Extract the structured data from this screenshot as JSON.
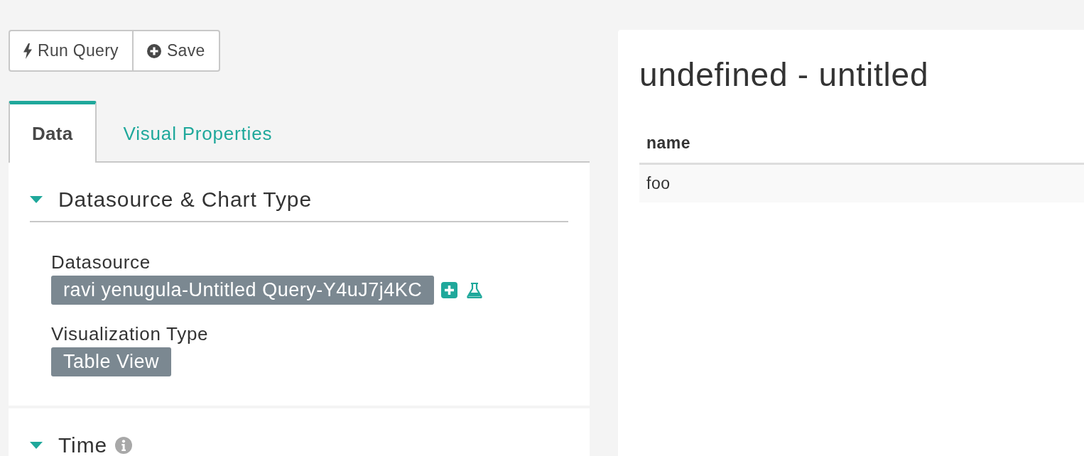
{
  "toolbar": {
    "buttons": [
      {
        "kind": "run",
        "label": "Run Query"
      },
      {
        "kind": "save",
        "label": "Save"
      }
    ]
  },
  "tabs": [
    {
      "label": "Data",
      "selected": true
    },
    {
      "label": "Visual Properties",
      "selected": false
    }
  ],
  "sections": [
    {
      "title": "Datasource & Chart Type",
      "expanded": true,
      "info": false,
      "fields": [
        {
          "kind": "datasource",
          "label": "Datasource",
          "value": "ravi yenugula-Untitled Query-Y4uJ7j4KC"
        },
        {
          "kind": "select",
          "label": "Visualization Type",
          "value": "Table View"
        }
      ]
    },
    {
      "title": "Time",
      "expanded": true,
      "info": true
    }
  ],
  "result": {
    "title": "undefined - untitled",
    "table": {
      "columns": [
        "name"
      ],
      "rows": [
        [
          "foo"
        ]
      ]
    }
  }
}
